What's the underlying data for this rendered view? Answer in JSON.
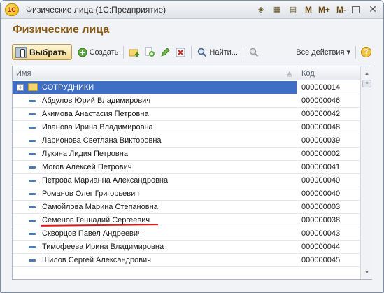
{
  "window": {
    "title": "Физические лица (1С:Предприятие)",
    "logo_text": "1С",
    "m_labels": [
      "M",
      "M+",
      "M-"
    ]
  },
  "form": {
    "heading": "Физические лица"
  },
  "toolbar": {
    "select_label": "Выбрать",
    "create_label": "Создать",
    "find_label": "Найти...",
    "all_actions_label": "Все действия ▾",
    "help_label": "?"
  },
  "grid": {
    "columns": [
      "Имя",
      "Код"
    ],
    "rows": [
      {
        "name": "СОТРУДНИКИ",
        "code": "000000014",
        "type": "group"
      },
      {
        "name": "Абдулов Юрий Владимирович",
        "code": "000000046",
        "type": "item"
      },
      {
        "name": "Акимова Анастасия Петровна",
        "code": "000000042",
        "type": "item"
      },
      {
        "name": "Иванова Ирина Владимировна",
        "code": "000000048",
        "type": "item"
      },
      {
        "name": "Ларионова Светлана Викторовна",
        "code": "000000039",
        "type": "item"
      },
      {
        "name": "Лукина  Лидия Петровна",
        "code": "000000002",
        "type": "item"
      },
      {
        "name": "Могов Алексей Петрович",
        "code": "000000041",
        "type": "item"
      },
      {
        "name": "Петрова Марианна Александровна",
        "code": "000000040",
        "type": "item"
      },
      {
        "name": "Романов Олег Григорьевич",
        "code": "000000040",
        "type": "item"
      },
      {
        "name": "Самойлова Марина Степановна",
        "code": "000000003",
        "type": "item"
      },
      {
        "name": "Семенов Геннадий Сергеевич",
        "code": "000000038",
        "type": "item",
        "highlight": true
      },
      {
        "name": "Скворцов Павел Андреевич",
        "code": "000000043",
        "type": "item"
      },
      {
        "name": "Тимофеева Ирина Владимировна",
        "code": "000000044",
        "type": "item"
      },
      {
        "name": "Шилов Сергей Александрович",
        "code": "000000045",
        "type": "item"
      }
    ]
  },
  "colors": {
    "heading": "#8a5a10",
    "selection": "#3f6fc5",
    "annotation": "#e01818"
  }
}
